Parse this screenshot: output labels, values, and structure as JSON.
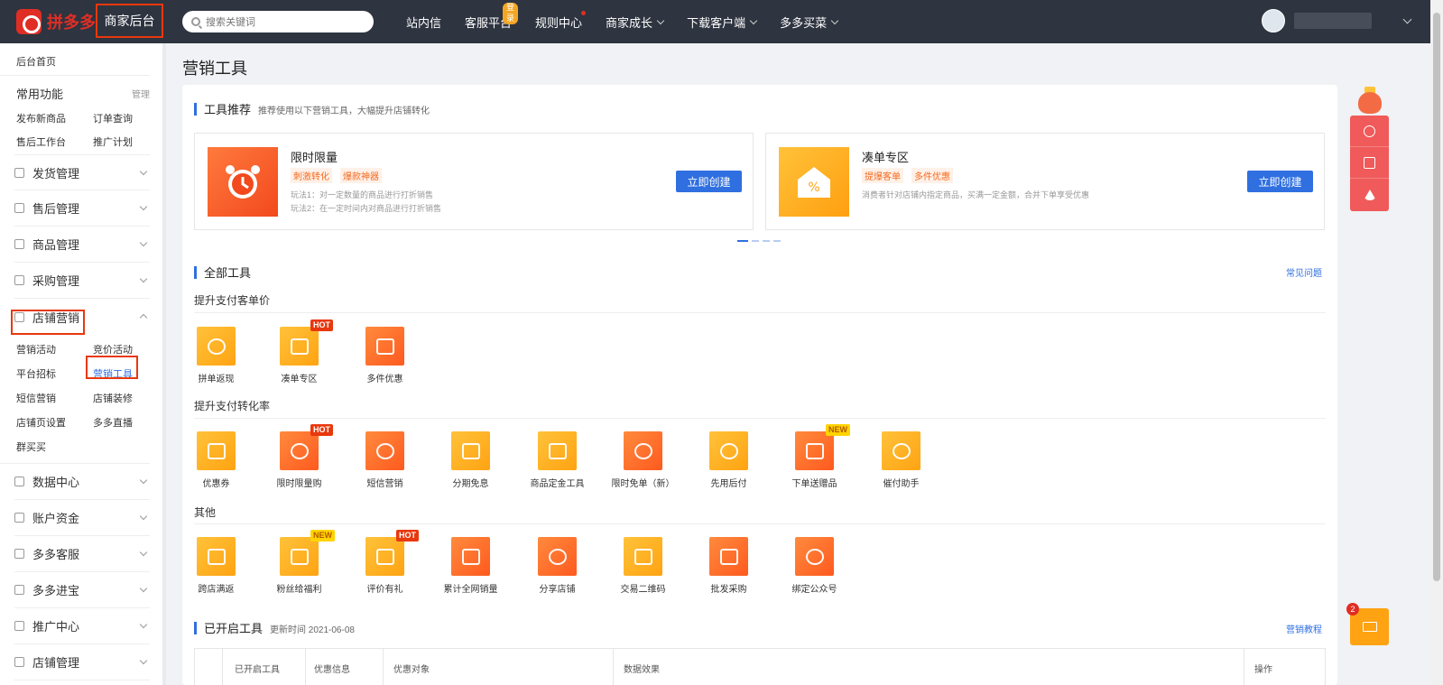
{
  "header": {
    "logo_text": "拼多多",
    "shop_label": "商家后台",
    "search_placeholder": "搜索关键词",
    "nav": [
      {
        "label": "站内信"
      },
      {
        "label": "客服平台",
        "tag": "登录"
      },
      {
        "label": "规则中心"
      },
      {
        "label": "商家成长"
      },
      {
        "label": "下载客户端"
      },
      {
        "label": "多多买菜"
      }
    ]
  },
  "sidebar": {
    "home": "后台首页",
    "common_title": "常用功能",
    "manage": "管理",
    "common_items": [
      "发布新商品",
      "订单查询",
      "售后工作台",
      "推广计划"
    ],
    "sections_top": [
      "发货管理",
      "售后管理",
      "商品管理",
      "采购管理"
    ],
    "marketing": "店铺营销",
    "marketing_items": [
      "营销活动",
      "竞价活动",
      "平台招标",
      "营销工具",
      "短信营销",
      "店铺装修",
      "店铺页设置",
      "多多直播",
      "群买买"
    ],
    "sections_bottom": [
      "数据中心",
      "账户资金",
      "多多客服",
      "多多进宝",
      "推广中心",
      "店铺管理"
    ]
  },
  "page_title": "营销工具",
  "recommend": {
    "title": "工具推荐",
    "desc": "推荐使用以下营销工具，大幅提升店铺转化",
    "cards": [
      {
        "title": "限时限量",
        "tags": [
          "刺激转化",
          "爆款神器"
        ],
        "lines": [
          "玩法1：对一定数量的商品进行打折销售",
          "玩法2：在一定时间内对商品进行打折销售"
        ],
        "button": "立即创建"
      },
      {
        "title": "凑单专区",
        "tags": [
          "提爆客单",
          "多件优惠"
        ],
        "lines": [
          "消费者针对店铺内指定商品，买满一定金额，合并下单享受优惠"
        ],
        "button": "立即创建"
      }
    ]
  },
  "all_tools": {
    "title": "全部工具",
    "faq": "常见问题",
    "groups": [
      {
        "title": "提升支付客单价",
        "tools": [
          {
            "label": "拼单返现",
            "badge": ""
          },
          {
            "label": "凑单专区",
            "badge": "HOT"
          },
          {
            "label": "多件优惠",
            "badge": ""
          }
        ]
      },
      {
        "title": "提升支付转化率",
        "tools": [
          {
            "label": "优惠券",
            "badge": ""
          },
          {
            "label": "限时限量购",
            "badge": "HOT"
          },
          {
            "label": "短信营销",
            "badge": ""
          },
          {
            "label": "分期免息",
            "badge": ""
          },
          {
            "label": "商品定金工具",
            "badge": ""
          },
          {
            "label": "限时免单（新）",
            "badge": ""
          },
          {
            "label": "先用后付",
            "badge": ""
          },
          {
            "label": "下单送赠品",
            "badge": "NEW"
          },
          {
            "label": "催付助手",
            "badge": ""
          }
        ]
      },
      {
        "title": "其他",
        "tools": [
          {
            "label": "跨店满返",
            "badge": ""
          },
          {
            "label": "粉丝给福利",
            "badge": "NEW"
          },
          {
            "label": "评价有礼",
            "badge": "HOT"
          },
          {
            "label": "累计全网销量",
            "badge": ""
          },
          {
            "label": "分享店铺",
            "badge": ""
          },
          {
            "label": "交易二维码",
            "badge": ""
          },
          {
            "label": "批发采购",
            "badge": ""
          },
          {
            "label": "绑定公众号",
            "badge": ""
          }
        ]
      }
    ]
  },
  "opened": {
    "title": "已开启工具",
    "update": "更新时间 2021-06-08",
    "tutorial": "营销教程",
    "columns": [
      "已开启工具",
      "优惠信息",
      "优惠对象",
      "数据效果",
      "操作"
    ]
  },
  "float": {
    "mail_count": "2"
  },
  "colors": {
    "accent": "#2f6fe0",
    "brand": "#e02e24",
    "highlight": "#e8380d",
    "topbar": "#2e3440"
  }
}
